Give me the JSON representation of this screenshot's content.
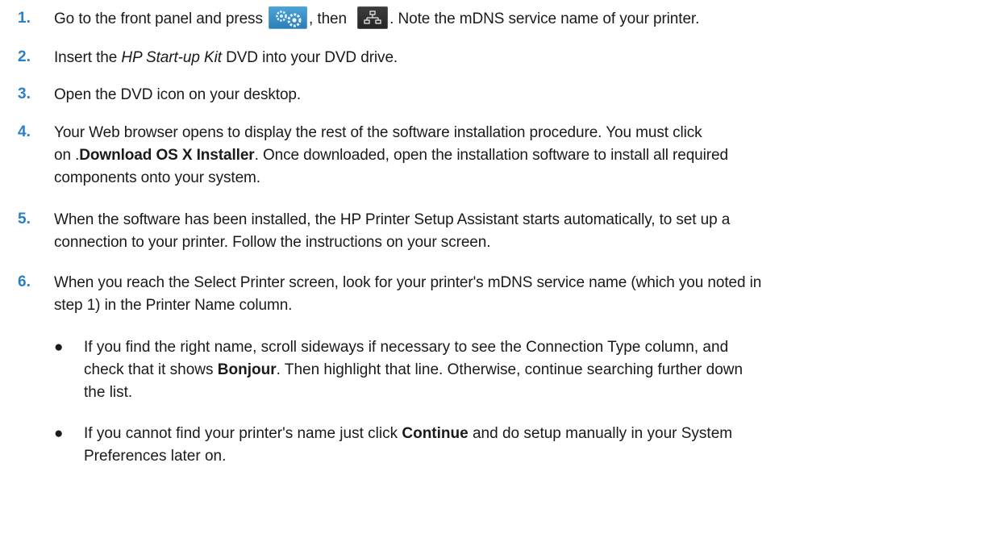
{
  "steps": [
    {
      "num": "1.",
      "parts": {
        "a": "Go to the front panel and press",
        "b": ", then",
        "c": ". Note the mDNS service name of your printer."
      },
      "icons": [
        "settings-gears-icon",
        "network-icon"
      ]
    },
    {
      "num": "2.",
      "parts": {
        "a": "Insert the ",
        "em": "HP Start-up Kit",
        "b": " DVD into your DVD drive."
      }
    },
    {
      "num": "3.",
      "parts": {
        "a": "Open the DVD icon on your desktop."
      }
    },
    {
      "num": "4.",
      "parts": {
        "line1": "Your Web browser opens to display the rest of the software installation procedure. You must click",
        "line2a": "on .",
        "strong": "Download OS X Installer",
        "line2b": ". Once downloaded, open the installation software to install all required",
        "line3": "components onto your system."
      }
    },
    {
      "num": "5.",
      "parts": {
        "line1": "When the software has been installed, the HP Printer Setup Assistant starts automatically, to set up a",
        "line2": "connection to your printer. Follow the instructions on your screen."
      }
    },
    {
      "num": "6.",
      "parts": {
        "line1": "When you reach the Select Printer screen, look for your printer's mDNS service name (which you noted in",
        "line2": "step 1) in the Printer Name column."
      }
    }
  ],
  "bullets": [
    {
      "glyph": "●",
      "line1": "If you find the right name, scroll sideways if necessary to see the Connection Type column, and",
      "line2a": "check that it shows ",
      "strong": "Bonjour",
      "line2b": ". Then highlight that line. Otherwise, continue searching further down",
      "line3": "the list."
    },
    {
      "glyph": "●",
      "line1a": "If you cannot find your printer's name just click ",
      "strong": "Continue",
      "line1b": " and do setup manually in your System",
      "line2": "Preferences later on."
    }
  ]
}
